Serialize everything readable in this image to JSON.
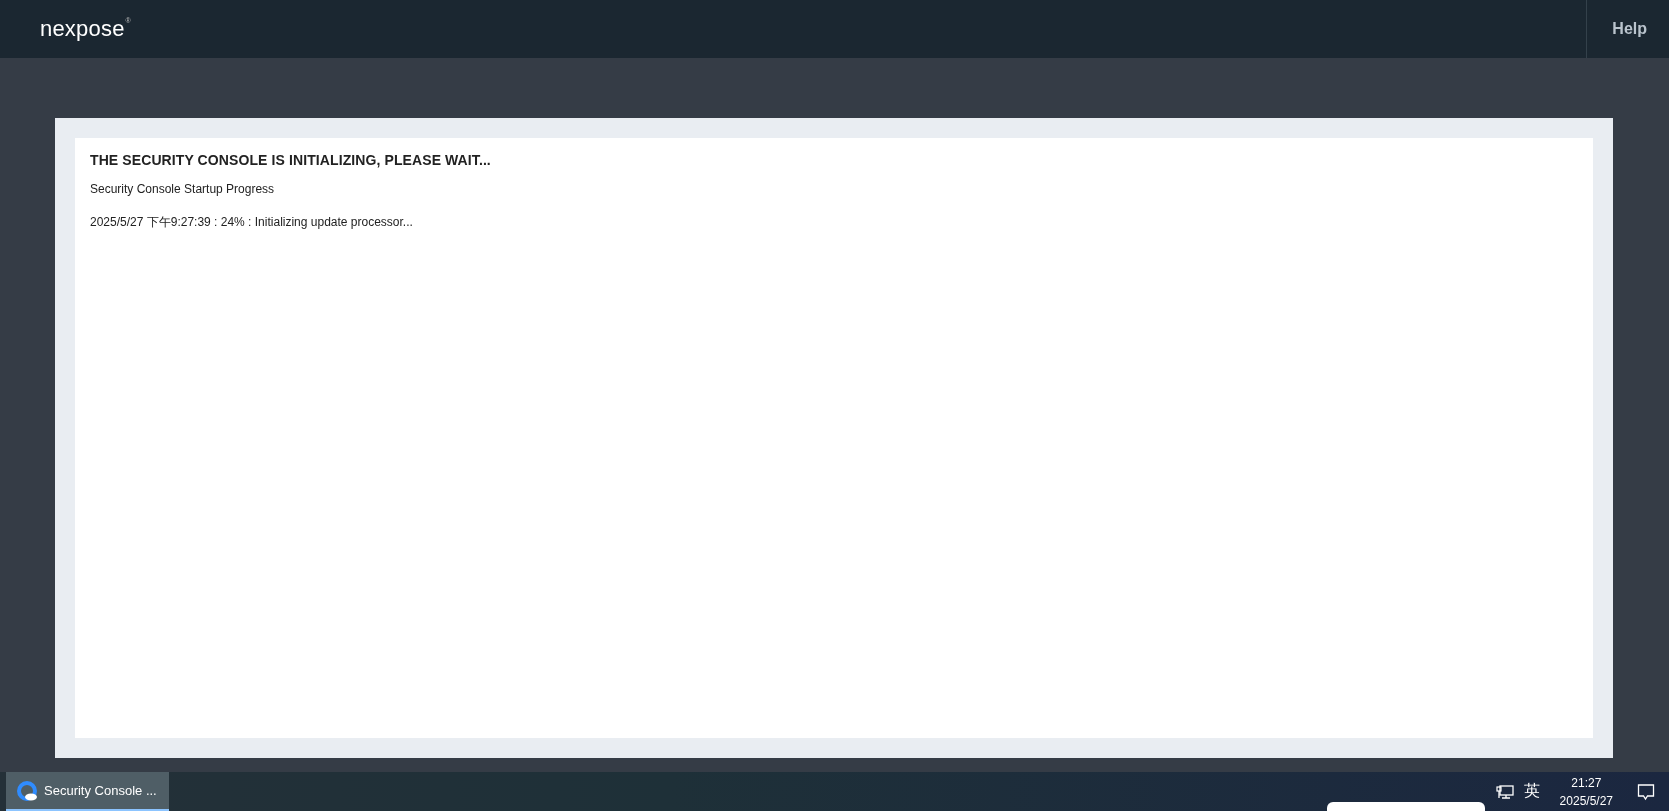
{
  "header": {
    "logo": "nexpose",
    "logo_mark": "®",
    "help": "Help"
  },
  "panel": {
    "title": "THE SECURITY CONSOLE IS INITIALIZING, PLEASE WAIT...",
    "subtitle": "Security Console Startup Progress",
    "progress_lines": [
      "2025/5/27 下午9:27:39 : 24% : Initializing update processor..."
    ]
  },
  "taskbar": {
    "apps": [
      {
        "label": "Security Console ...",
        "selected": true
      }
    ],
    "input_method": "英",
    "time": "21:27",
    "date": "2025/5/27"
  }
}
